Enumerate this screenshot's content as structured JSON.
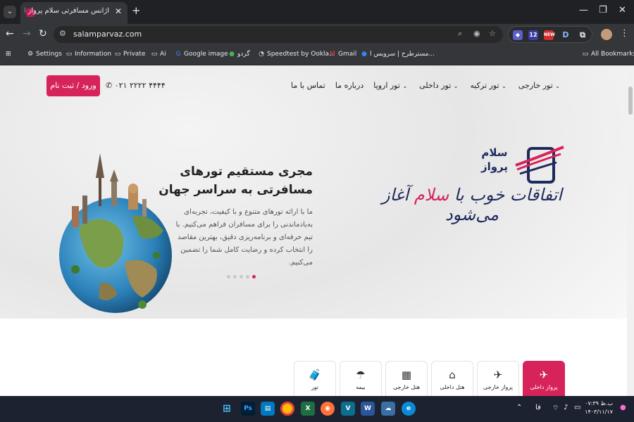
{
  "browser": {
    "tab_title": "آژانس مسافرتی سلام پرواز ایرانیان",
    "tab_close": "✕",
    "new_tab": "+",
    "url": "salamparvaz.com",
    "window_controls": [
      "—",
      "❐",
      "✕"
    ],
    "extension_badges": {
      "count": "12",
      "new": "NEW",
      "d": "D"
    },
    "bookmarks": [
      {
        "label": "Settings",
        "icon": "gear-icon"
      },
      {
        "label": "Information",
        "icon": "folder-icon"
      },
      {
        "label": "Private",
        "icon": "folder-icon"
      },
      {
        "label": "Ai",
        "icon": "folder-icon"
      },
      {
        "label": "Google image",
        "icon": "google-icon"
      },
      {
        "label": "گردو",
        "icon": "site-icon"
      },
      {
        "label": "Speedtest by Ookla...",
        "icon": "speedtest-icon"
      },
      {
        "label": "Gmail",
        "icon": "gmail-icon"
      },
      {
        "label": "مسترطرح | سرویس ا...",
        "icon": "site-icon"
      }
    ],
    "all_bookmarks": "All Bookmarks"
  },
  "site": {
    "login_button": "ورود / ثبت نام",
    "phone": "۰۲۱ ۲۲۲۲ ۴۴۴۴",
    "nav": [
      "تور خارجی",
      "تور ترکیه",
      "تور داخلی",
      "تور اروپا",
      "درباره ما",
      "تماس با ما"
    ],
    "nav_has_dropdown": [
      true,
      true,
      true,
      true,
      false,
      false
    ],
    "hero": {
      "title": "مجری مستقیم تورهای مسافرتی به سراسر جهان",
      "text": "ما با ارائه تورهای متنوع و با کیفیت، تجربه‌ای به‌یادماندنی را برای مسافران فراهم می‌کنیم. با تیم حرفه‌ای و برنامه‌ریزی دقیق، بهترین مقاصد را انتخاب کرده و رضایت کامل شما را تضمین می‌کنیم.",
      "slides": 5,
      "active_slide": 1
    },
    "logo_text": "سلام پرواز",
    "slogan_before": "اتفاقات خوب با ",
    "slogan_highlight": "سلام",
    "slogan_after": " آغاز می‌شود",
    "services": [
      {
        "label": "پرواز داخلی",
        "icon": "plane-icon",
        "active": true
      },
      {
        "label": "پرواز خارجی",
        "icon": "plane-takeoff-icon",
        "active": false
      },
      {
        "label": "هتل داخلی",
        "icon": "house-icon",
        "active": false
      },
      {
        "label": "هتل خارجی",
        "icon": "building-icon",
        "active": false
      },
      {
        "label": "بیمه",
        "icon": "umbrella-icon",
        "active": false
      },
      {
        "label": "تور",
        "icon": "luggage-icon",
        "active": false
      }
    ]
  },
  "taskbar": {
    "apps": [
      "start",
      "Ps",
      "Trello",
      "Chrome",
      "Excel",
      "Firefox",
      "V",
      "Word",
      "Edge-like",
      "Edge"
    ],
    "lang": "فا",
    "time": "۰۷:۳۹ ب.ظ",
    "date": "۱۴۰۳/۱۱/۱۷"
  },
  "colors": {
    "accent": "#d6245a",
    "brand_navy": "#1f2a5c",
    "chrome_dark": "#202124",
    "taskbar": "#1c2230"
  }
}
